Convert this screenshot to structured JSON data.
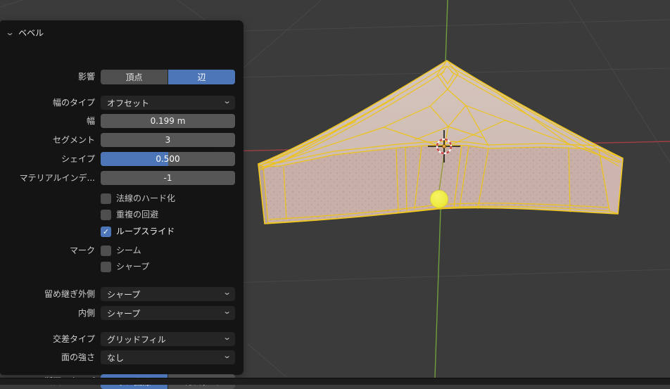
{
  "icons": {
    "collapse": "⌄",
    "chevron_down": "⌄",
    "check": "✓"
  },
  "panel": {
    "title": "ベベル",
    "affect": {
      "label": "影響",
      "options": [
        "頂点",
        "辺"
      ],
      "selected": "辺"
    },
    "width_type": {
      "label": "幅のタイプ",
      "value": "オフセット"
    },
    "width": {
      "label": "幅",
      "value": "0.199 m"
    },
    "segments": {
      "label": "セグメント",
      "value": "3"
    },
    "shape": {
      "label": "シェイプ",
      "value": "0.500",
      "fill_ratio": 0.5
    },
    "material_index": {
      "label": "マテリアルインデ...",
      "value": "-1"
    },
    "harden_normals": {
      "label": "法線のハード化",
      "checked": false
    },
    "clamp_overlap": {
      "label": "重複の回避",
      "checked": false
    },
    "loop_slide": {
      "label": "ループスライド",
      "checked": true
    },
    "mark": {
      "label": "マーク",
      "seam": "シーム",
      "seam_checked": false,
      "sharp": "シャープ",
      "sharp_checked": false
    },
    "miter_outer": {
      "label": "留め継ぎ外側",
      "value": "シャープ"
    },
    "miter_inner": {
      "label": "内側",
      "value": "シャープ"
    },
    "intersection_type": {
      "label": "交差タイプ",
      "value": "グリッドフィル"
    },
    "face_strength": {
      "label": "面の強さ",
      "value": "なし"
    },
    "profile_type": {
      "label": "断面のタイプ",
      "options": [
        "ラメ曲線",
        "カスタム"
      ],
      "selected": "ラメ曲線"
    }
  },
  "colors": {
    "accent_blue": "#4d76b8",
    "panel_background": "#131313",
    "viewport_background": "#3b3b3b",
    "grid_line": "#484848",
    "axis_x_red": "#9e3f44",
    "axis_z_green": "#6f9f3e",
    "mesh_wireframe_yellow": "#ecc31a",
    "mesh_top_surface": "#cfbdb5",
    "mesh_front_face": "#c8b0a9",
    "object_origin_yellow": "#f0ee3e"
  },
  "viewport": {
    "mode": "edit-mode-3d-view",
    "object": "beveled wing mesh",
    "overlays": [
      "x-axis",
      "z-axis",
      "floor-grid",
      "3d-cursor",
      "object-origin"
    ]
  }
}
